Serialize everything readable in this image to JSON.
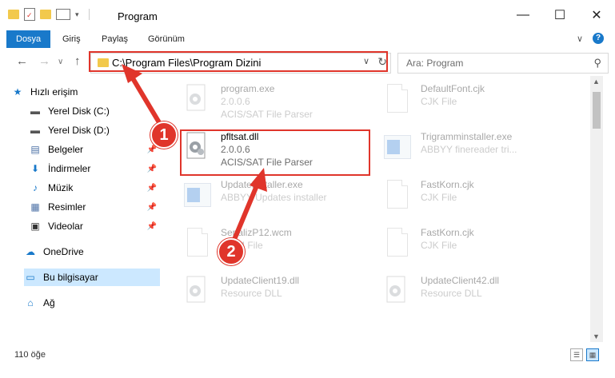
{
  "window": {
    "title": "Program",
    "minimize_glyph": "—",
    "maximize_glyph": "☐",
    "close_glyph": "✕"
  },
  "ribbon": {
    "tabs": [
      {
        "label": "Dosya",
        "active": true
      },
      {
        "label": "Giriş"
      },
      {
        "label": "Paylaş"
      },
      {
        "label": "Görünüm"
      }
    ],
    "expand_glyph": "∨",
    "help_glyph": "?"
  },
  "nav": {
    "back_glyph": "←",
    "forward_glyph": "→",
    "recent_glyph": "∨",
    "up_glyph": "↑"
  },
  "address": {
    "path": "C:\\Program Files\\Program Dizini",
    "dropdown_glyph": "∨",
    "refresh_glyph": "↻"
  },
  "search": {
    "placeholder": "Ara: Program",
    "icon_glyph": "⚲"
  },
  "sidebar": {
    "items": [
      {
        "label": "Hızlı erişim",
        "icon": "star-icon",
        "glyph": "★",
        "color": "#1979ca"
      },
      {
        "label": "Yerel Disk (C:)",
        "icon": "drive-icon",
        "glyph": "▬",
        "color": "#555555"
      },
      {
        "label": "Yerel Disk (D:)",
        "icon": "drive-icon",
        "glyph": "▬",
        "color": "#555555"
      },
      {
        "label": "Belgeler",
        "icon": "documents-icon",
        "glyph": "▤",
        "color": "#4a6fa5"
      },
      {
        "label": "İndirmeler",
        "icon": "downloads-icon",
        "glyph": "⬇",
        "color": "#1979ca"
      },
      {
        "label": "Müzik",
        "icon": "music-icon",
        "glyph": "♪",
        "color": "#1979ca"
      },
      {
        "label": "Resimler",
        "icon": "pictures-icon",
        "glyph": "▦",
        "color": "#4a6fa5"
      },
      {
        "label": "Videolar",
        "icon": "videos-icon",
        "glyph": "▣",
        "color": "#333333"
      },
      {
        "label": "OneDrive",
        "icon": "onedrive-icon",
        "glyph": "☁",
        "color": "#1979ca"
      },
      {
        "label": "Bu bilgisayar",
        "icon": "computer-icon",
        "glyph": "▭",
        "color": "#1979ca"
      },
      {
        "label": "Ağ",
        "icon": "network-icon",
        "glyph": "⌂",
        "color": "#1979ca"
      }
    ],
    "pin_glyph": "📌"
  },
  "files": [
    {
      "name": "program.exe",
      "l2": "2.0.0.6",
      "l3": "ACIS/SAT File Parser",
      "kind": "gear",
      "faded": true
    },
    {
      "name": "DefaultFont.cjk",
      "l2": "CJK File",
      "l3": "",
      "kind": "doc",
      "faded": true
    },
    {
      "name": "pfltsat.dll",
      "l2": "2.0.0.6",
      "l3": "ACIS/SAT File Parser",
      "kind": "gear",
      "faded": false
    },
    {
      "name": "Trigramminstaller.exe",
      "l2": "ABBYY finereader tri...",
      "l3": "",
      "kind": "installer",
      "faded": true
    },
    {
      "name": "UpdateInstaller.exe",
      "l2": "ABBYY Updates installer",
      "l3": "",
      "kind": "installer",
      "faded": true
    },
    {
      "name": "FastKorn.cjk",
      "l2": "CJK File",
      "l3": "",
      "kind": "doc",
      "faded": true
    },
    {
      "name": "SerializP12.wcm",
      "l2": "WCM File",
      "l3": "",
      "kind": "doc",
      "faded": true
    },
    {
      "name": "FastKorn.cjk",
      "l2": "CJK File",
      "l3": "",
      "kind": "doc",
      "faded": true
    },
    {
      "name": "UpdateClient19.dll",
      "l2": "Resource DLL",
      "l3": "",
      "kind": "gear",
      "faded": true
    },
    {
      "name": "UpdateClient42.dll",
      "l2": "Resource DLL",
      "l3": "",
      "kind": "gear",
      "faded": true
    }
  ],
  "annotations": {
    "step1": "1",
    "step2": "2",
    "color": "#e0352b"
  },
  "status": {
    "count": "110 öğe"
  }
}
